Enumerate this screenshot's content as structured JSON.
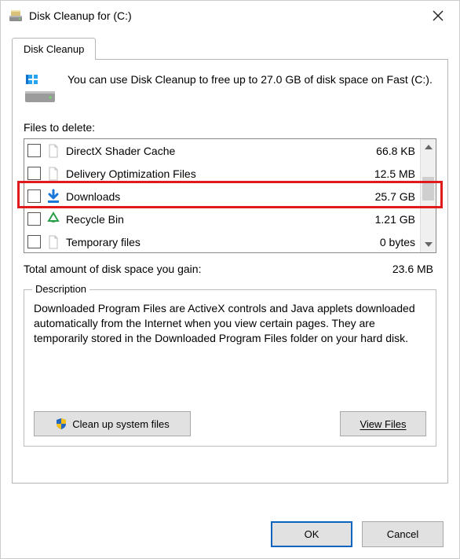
{
  "title": "Disk Cleanup for  (C:)",
  "tab_label": "Disk Cleanup",
  "intro": "You can use Disk Cleanup to free up to 27.0 GB of disk space on Fast (C:).",
  "files_label": "Files to delete:",
  "files": [
    {
      "name": "DirectX Shader Cache",
      "size": "66.8 KB",
      "icon": "page",
      "checked": false
    },
    {
      "name": "Delivery Optimization Files",
      "size": "12.5 MB",
      "icon": "page",
      "checked": false
    },
    {
      "name": "Downloads",
      "size": "25.7 GB",
      "icon": "download",
      "checked": false
    },
    {
      "name": "Recycle Bin",
      "size": "1.21 GB",
      "icon": "recycle",
      "checked": false
    },
    {
      "name": "Temporary files",
      "size": "0 bytes",
      "icon": "page",
      "checked": false
    }
  ],
  "highlight_index": 2,
  "total_label": "Total amount of disk space you gain:",
  "total_value": "23.6 MB",
  "group_legend": "Description",
  "description": "Downloaded Program Files are ActiveX controls and Java applets downloaded automatically from the Internet when you view certain pages. They are temporarily stored in the Downloaded Program Files folder on your hard disk.",
  "btn_cleanup": "Clean up system files",
  "btn_view": "View Files",
  "btn_ok": "OK",
  "btn_cancel": "Cancel"
}
